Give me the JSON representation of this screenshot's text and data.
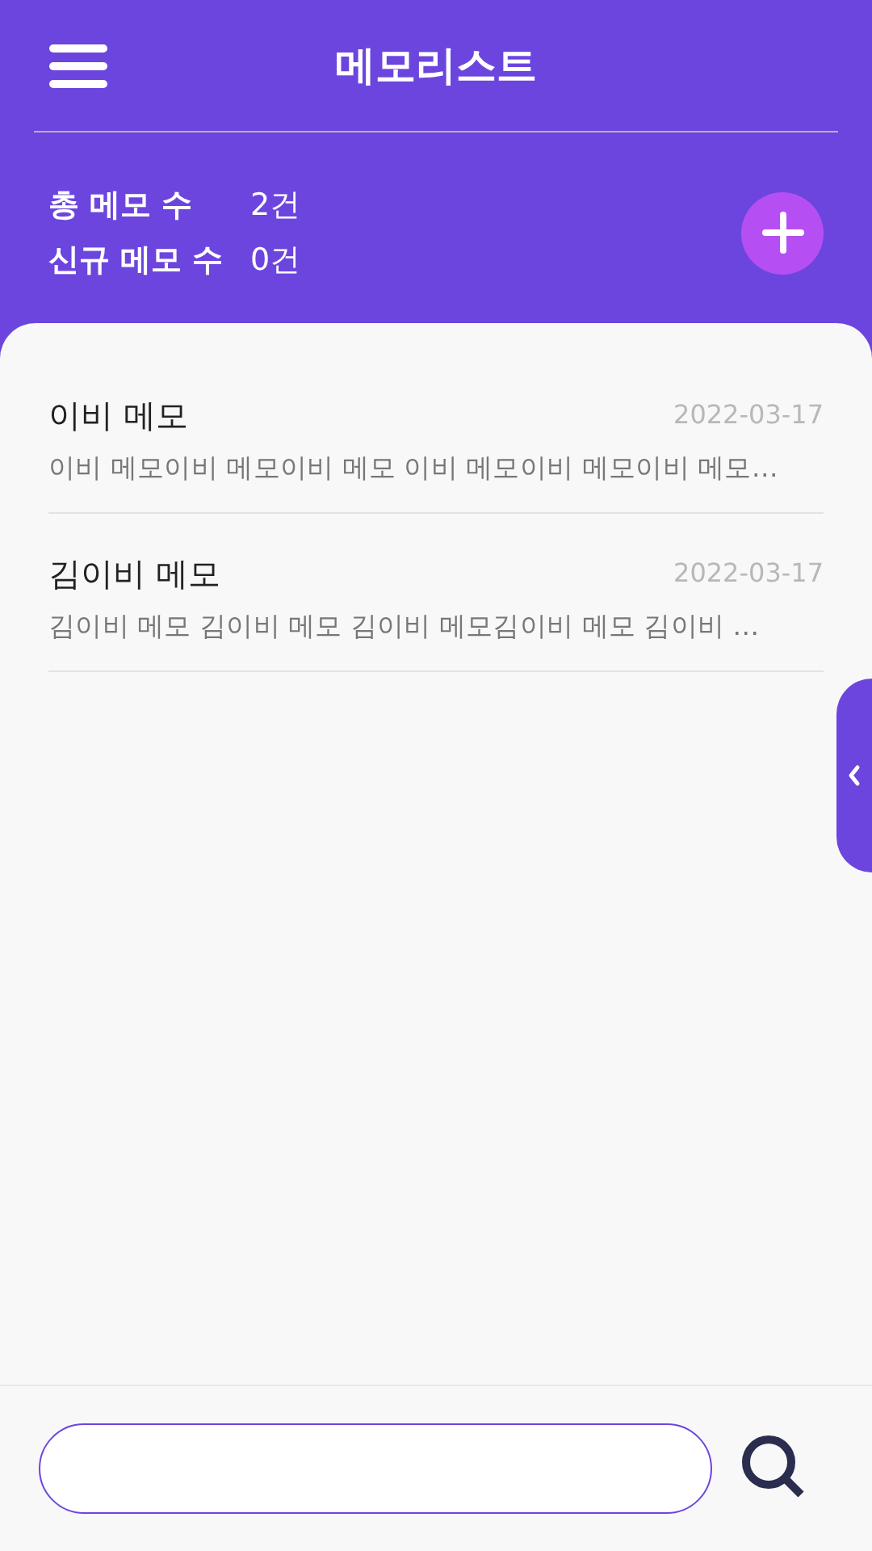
{
  "header": {
    "title": "메모리스트"
  },
  "stats": [
    {
      "label": "총 메모 수",
      "value": "2건"
    },
    {
      "label": "신규 메모 수",
      "value": "0건"
    }
  ],
  "memos": [
    {
      "title": "이비 메모",
      "date": "2022-03-17",
      "preview": "이비 메모이비 메모이비 메모 이비 메모이비 메모이비 메모…"
    },
    {
      "title": "김이비 메모",
      "date": "2022-03-17",
      "preview": "김이비 메모 김이비 메모 김이비 메모김이비 메모 김이비 …"
    }
  ]
}
